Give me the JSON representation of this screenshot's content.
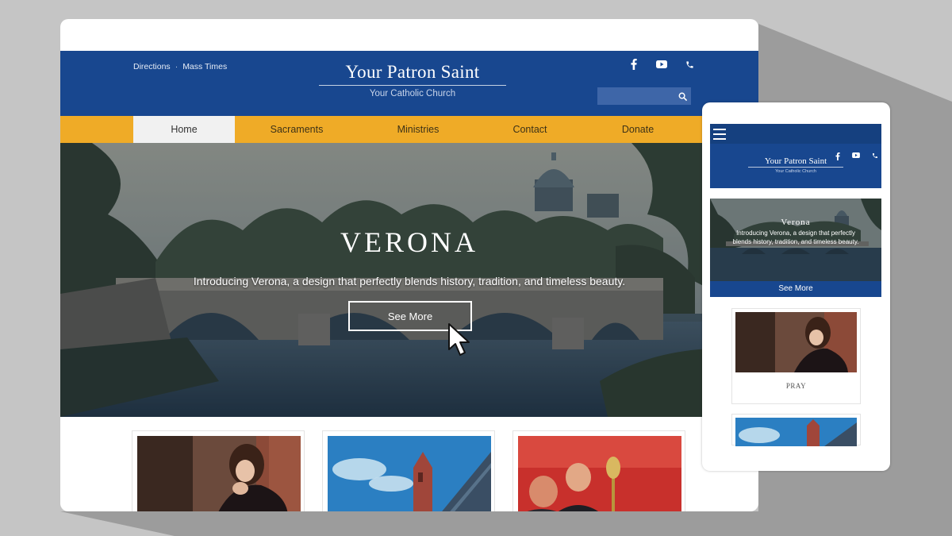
{
  "header": {
    "links": [
      "Directions",
      "Mass Times"
    ],
    "separator": "·",
    "logo_title": "Your Patron Saint",
    "logo_subtitle": "Your Catholic Church",
    "search_placeholder": "",
    "social": [
      "facebook-icon",
      "youtube-icon",
      "phone-icon"
    ]
  },
  "nav": {
    "items": [
      "Home",
      "Sacraments",
      "Ministries",
      "Contact",
      "Donate"
    ],
    "active": "Home"
  },
  "hero": {
    "title": "VERONA",
    "subtitle": "Introducing Verona, a design that perfectly blends history, tradition, and timeless beauty.",
    "button": "See More"
  },
  "mobile": {
    "logo_title": "Your Patron Saint",
    "logo_subtitle": "Your Catholic Church",
    "hero_title": "Verona",
    "hero_subtitle": "Introducing Verona, a design that perfectly blends history, tradition, and timeless beauty.",
    "button": "See More",
    "card_label": "PRAY"
  },
  "colors": {
    "header_blue": "#18478f",
    "nav_gold": "#efab27",
    "background": "#c5c5c5"
  }
}
